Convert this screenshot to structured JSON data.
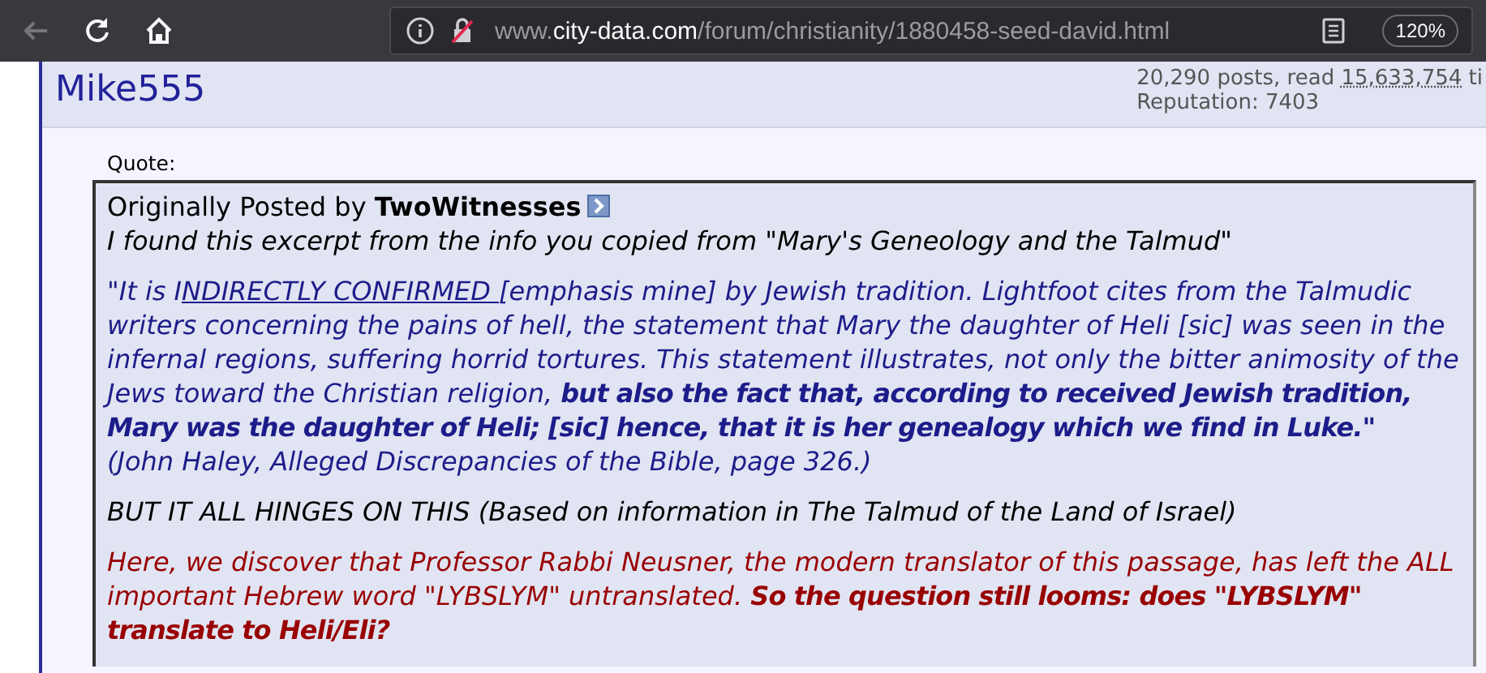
{
  "toolbar": {
    "back_disabled": true,
    "url": [
      {
        "text": "www.",
        "kind": "dim"
      },
      {
        "text": "city-data.com",
        "kind": "host"
      },
      {
        "text": "/forum/christianity/1880458-seed-david.html",
        "kind": "dim"
      }
    ],
    "zoom": "120%"
  },
  "post": {
    "username": "Mike555",
    "stats": "20,290 posts, read ",
    "read_count": "15,633,754",
    "stats_cut": " ti",
    "reputation": "Reputation: 7403",
    "quote_label": "Quote:",
    "quote": {
      "posted_by": "Originally Posted by ",
      "author": "TwoWitnesses",
      "paragraphs": [
        {
          "color": "#000000",
          "runs": [
            {
              "text": "I found this excerpt from the info you copied from \"Mary's Geneology and the Talmud\"",
              "kind": "plain"
            }
          ]
        },
        {
          "color": "#1c1c8a",
          "runs": [
            {
              "text": "\"It is I",
              "kind": "plain"
            },
            {
              "text": "NDIRECTLY CONFIRMED ",
              "kind": "underline"
            },
            {
              "text": "[emphasis mine] by Jewish tradition. Lightfoot cites from the Talmudic writers concerning the pains of hell, the statement that Mary the daughter of Heli [sic] was seen in the infernal regions, suffering horrid tortures. This statement illustrates, not only the bitter animosity of the Jews toward the Christian religion, ",
              "kind": "plain"
            },
            {
              "text": "but also the fact that, according to received Jewish tradition, Mary was the daughter of Heli; [sic] hence, that it is her genealogy which we find in Luke.\"",
              "kind": "bold"
            },
            {
              "text": "(John Haley, Alleged Discrepancies of the Bible, page 326.)",
              "kind": "line"
            }
          ]
        },
        {
          "color": "#000000",
          "runs": [
            {
              "text": "BUT IT ALL HINGES ON THIS (Based on information in The Talmud of the Land of Israel)",
              "kind": "plain"
            }
          ]
        },
        {
          "color": "#990000",
          "runs": [
            {
              "text": "Here, we discover that Professor Rabbi Neusner, the modern translator of this passage, has left the ALL important Hebrew word \"LYBSLYM\" untranslated. ",
              "kind": "plain"
            },
            {
              "text": "So the question still looms: does \"LYBSLYM\" translate to Heli/Eli?",
              "kind": "bold"
            }
          ]
        }
      ]
    }
  }
}
